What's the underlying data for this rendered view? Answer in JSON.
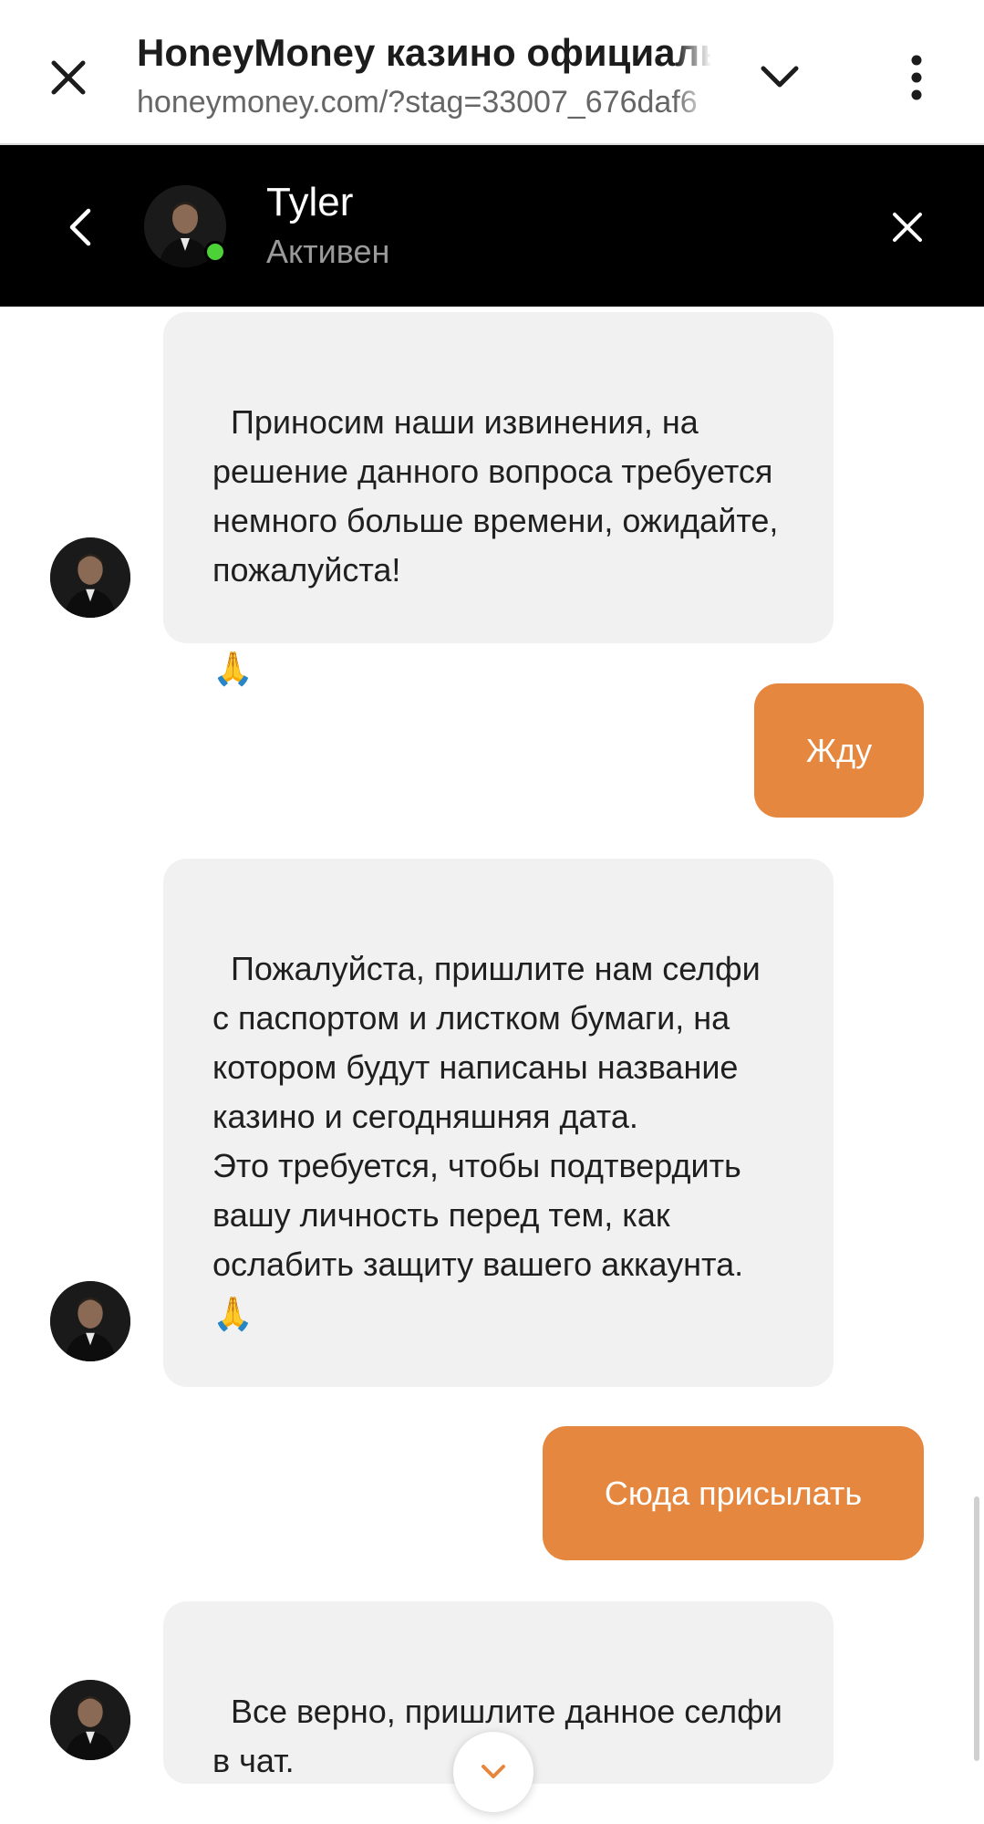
{
  "browser": {
    "title": "HoneyMoney казино официаль",
    "url": "honeymoney.com/?stag=33007_676daf6"
  },
  "chat_header": {
    "agent_name": "Tyler",
    "agent_status": "Активен",
    "status_color": "#4cd137"
  },
  "messages": [
    {
      "from": "agent",
      "text": "Приносим наши извинения, на решение данного вопроса требуется немного больше времени, ожидайте, пожалуйста!",
      "emoji": "🙏"
    },
    {
      "from": "user",
      "text": "Жду"
    },
    {
      "from": "agent",
      "text": "Пожалуйста, пришлите нам селфи с паспортом и листком бумаги, на котором будут написаны название казино и сегодняшняя дата.\nЭто требуется, чтобы подтвердить вашу личность перед тем, как ослабить защиту вашего аккаунта.",
      "emoji": "🙏"
    },
    {
      "from": "user",
      "text": "Сюда присылать"
    },
    {
      "from": "agent",
      "text": "Все верно, пришлите данное селфи в чат.",
      "emoji": ""
    }
  ],
  "colors": {
    "accent": "#e5873e",
    "incoming_bubble": "#f1f1f1",
    "header_bg": "#000000"
  },
  "icons": {
    "browser_close": "close-icon",
    "browser_expand": "chevron-down-icon",
    "browser_menu": "more-vertical-icon",
    "chat_back": "chevron-left-icon",
    "chat_close": "close-icon",
    "scroll_down": "chevron-down-icon"
  }
}
